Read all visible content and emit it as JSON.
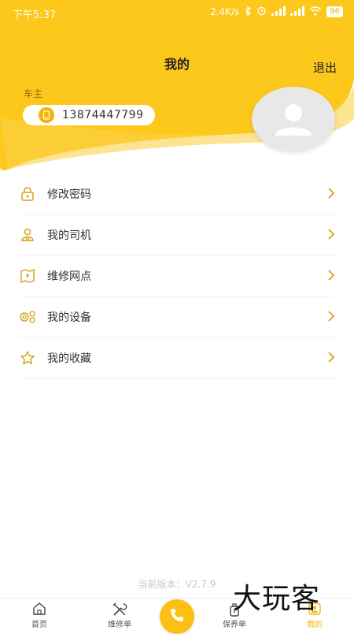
{
  "status": {
    "time": "下午5:37",
    "net_speed": "2.4K/s",
    "battery": "96"
  },
  "header": {
    "title": "我的",
    "logout_label": "退出",
    "role": "车主",
    "phone": "13874447799"
  },
  "menu": {
    "items": [
      {
        "label": "修改密码",
        "icon": "lock-icon"
      },
      {
        "label": "我的司机",
        "icon": "driver-icon"
      },
      {
        "label": "维修网点",
        "icon": "map-pin-icon"
      },
      {
        "label": "我的设备",
        "icon": "device-icon"
      },
      {
        "label": "我的收藏",
        "icon": "star-icon"
      }
    ]
  },
  "version": "当前版本：V2.7.9",
  "tabs": [
    {
      "label": "首页",
      "icon": "home-icon"
    },
    {
      "label": "维修单",
      "icon": "wrench-icon"
    },
    {
      "label": "保养单",
      "icon": "maintenance-icon"
    },
    {
      "label": "我的",
      "icon": "user-icon"
    }
  ],
  "watermark": "大玩客",
  "colors": {
    "accent": "#f4b400",
    "hero": "#fcc81b"
  }
}
